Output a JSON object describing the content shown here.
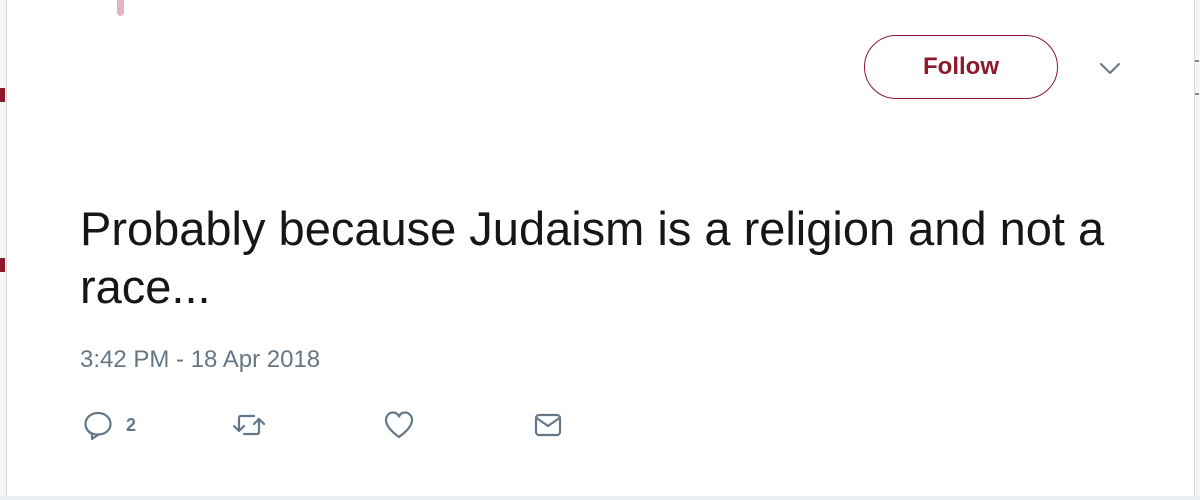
{
  "header": {
    "follow_label": "Follow",
    "caret_icon": "chevron-down-icon"
  },
  "tweet": {
    "text": "Probably because Judaism is a religion and not a race...",
    "timestamp": "3:42 PM - 18 Apr 2018"
  },
  "actions": {
    "reply": {
      "icon": "reply-icon",
      "count": "2"
    },
    "retweet": {
      "icon": "retweet-icon"
    },
    "like": {
      "icon": "heart-icon"
    },
    "dm": {
      "icon": "envelope-icon"
    }
  },
  "colors": {
    "accent": "#8b1a2b",
    "text": "#14171a",
    "muted": "#657786"
  }
}
